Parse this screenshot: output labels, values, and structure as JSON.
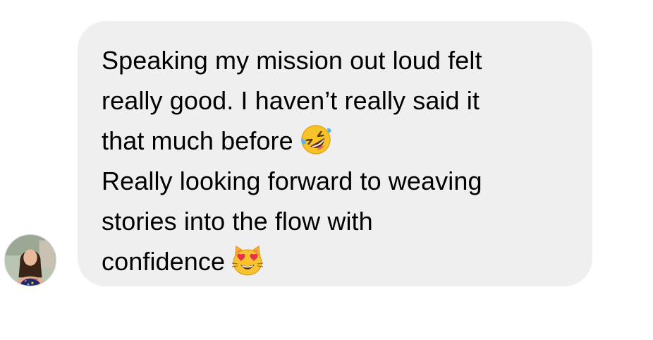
{
  "conversation": {
    "avatar_icon": "profile-avatar-woman",
    "message": {
      "lines": [
        "Speaking my mission out loud felt",
        "really good. I haven’t really said it",
        "that much before",
        "Really looking forward to weaving",
        "stories into the flow with",
        "confidence"
      ],
      "emojis": {
        "line3": "rolling-on-floor-laughing-emoji",
        "line6": "heart-eyes-cat-emoji"
      }
    }
  },
  "colors": {
    "bubble_background": "#efefef",
    "text": "#000000",
    "page_background": "#ffffff"
  }
}
